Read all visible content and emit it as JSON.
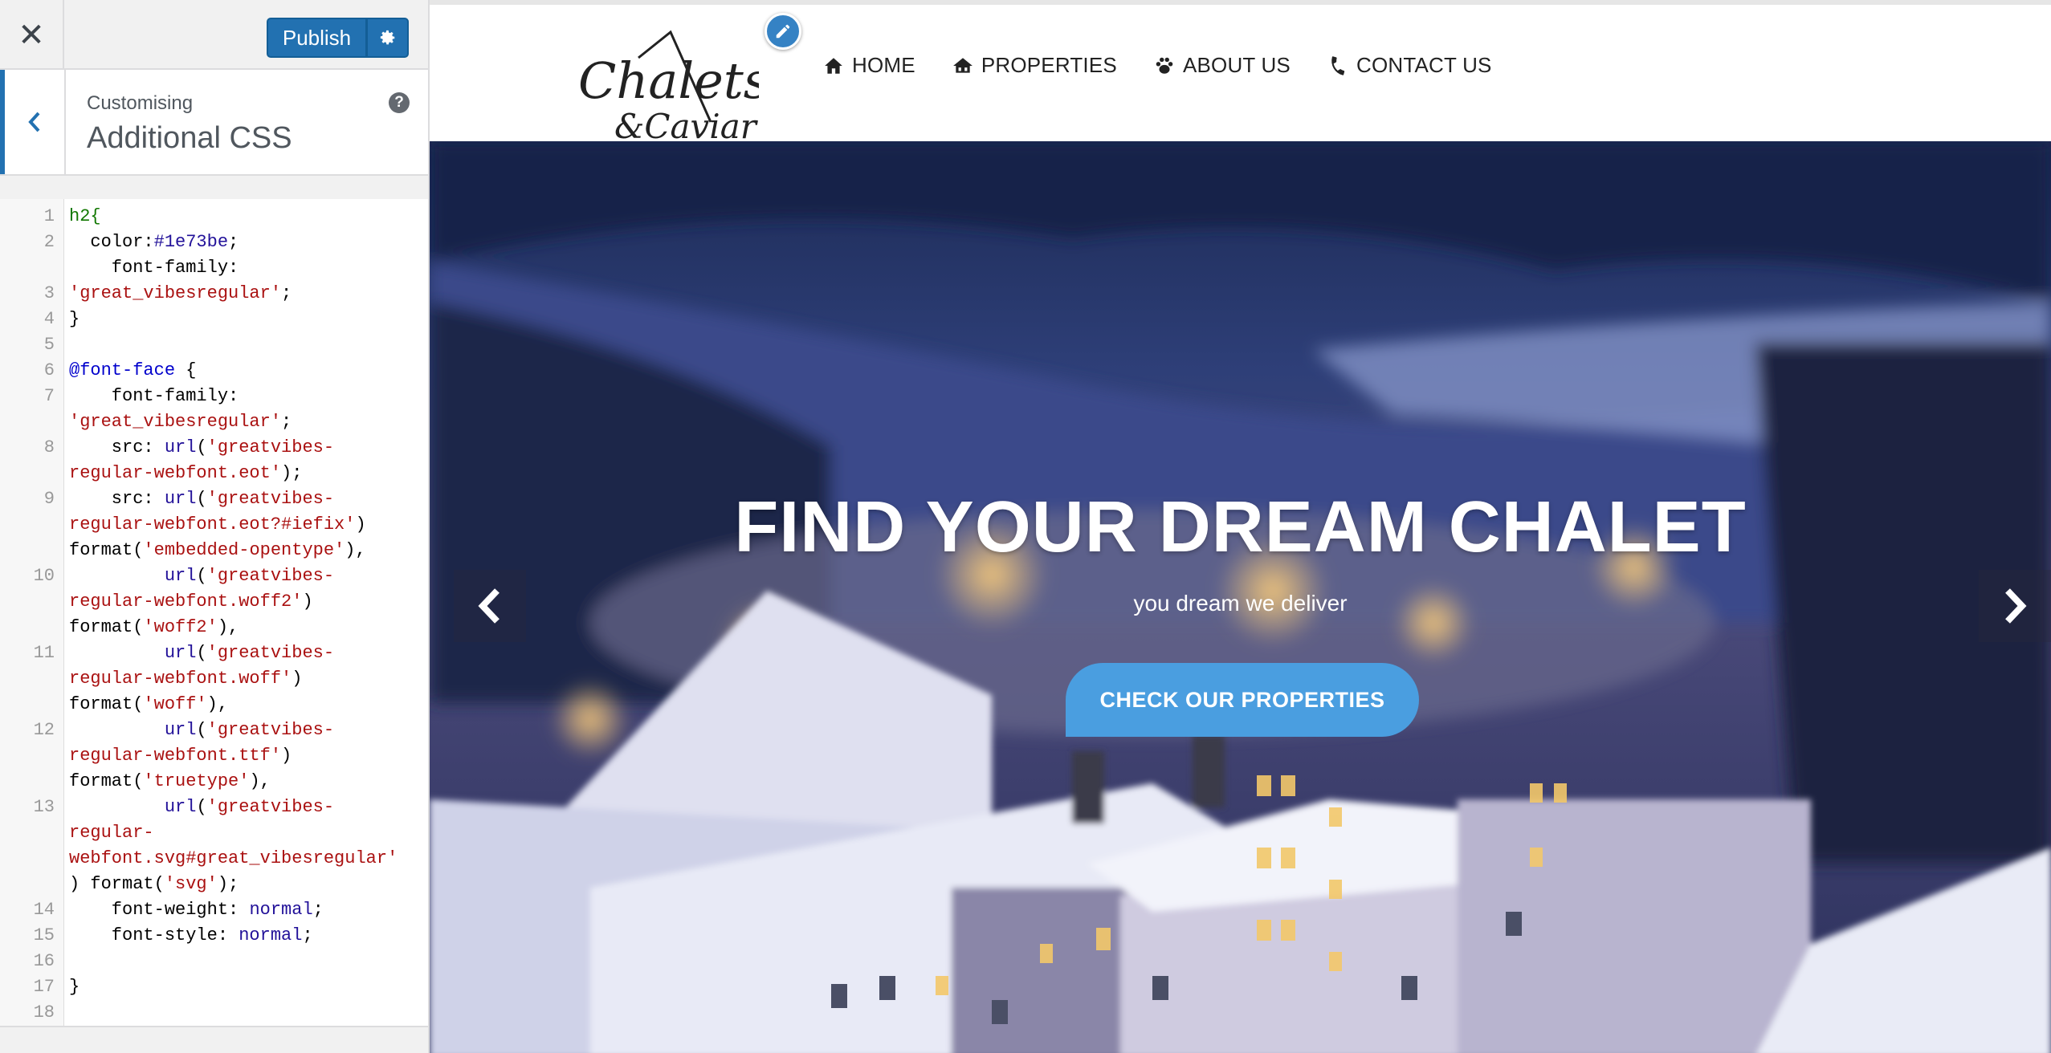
{
  "sidebar": {
    "close_icon": "close-icon",
    "publish_label": "Publish",
    "settings_icon": "gear-icon",
    "customising_label": "Customising",
    "section_title": "Additional CSS",
    "help_icon": "help-icon",
    "back_icon": "chevron-left-icon"
  },
  "code_lines": [
    {
      "num": "1"
    },
    {
      "num": "2"
    },
    {
      "num": ""
    },
    {
      "num": "3"
    },
    {
      "num": "4"
    },
    {
      "num": "5"
    },
    {
      "num": "6"
    },
    {
      "num": "7"
    },
    {
      "num": ""
    },
    {
      "num": "8"
    },
    {
      "num": ""
    },
    {
      "num": "9"
    },
    {
      "num": ""
    },
    {
      "num": ""
    },
    {
      "num": "10"
    },
    {
      "num": ""
    },
    {
      "num": ""
    },
    {
      "num": "11"
    },
    {
      "num": ""
    },
    {
      "num": ""
    },
    {
      "num": "12"
    },
    {
      "num": ""
    },
    {
      "num": ""
    },
    {
      "num": "13"
    },
    {
      "num": ""
    },
    {
      "num": ""
    },
    {
      "num": ""
    },
    {
      "num": "14"
    },
    {
      "num": "15"
    },
    {
      "num": "16"
    },
    {
      "num": "17"
    },
    {
      "num": "18"
    }
  ],
  "code_text": {
    "l1": "h2{",
    "l2_prop": "  color:",
    "l2_val": "#1e73be",
    "l2_end": ";",
    "l3a": "    font-family:",
    "l3b": "'great_vibesregular'",
    "l3b_end": ";",
    "l4": "}",
    "l6_kw": "@font-face",
    "l6_end": " {",
    "l7a": "    font-family:",
    "l7b": "'great_vibesregular'",
    "l7b_end": ";",
    "src": "    src: ",
    "url": "url",
    "l8a_str": "'greatvibes-",
    "l8b_str": "regular-webfont.eot'",
    "l8b_end": ");",
    "l9a_str": "'greatvibes-",
    "l9b_str": "regular-webfont.eot?#iefix'",
    "l9b_end": ")",
    "format": "format(",
    "l9c_str": "'embedded-opentype'",
    "l9c_end": "),",
    "indent": "         ",
    "l10a_str": "'greatvibes-",
    "l10b_str": "regular-webfont.woff2'",
    "l10b_end": ")",
    "l10c_str": "'woff2'",
    "l10c_end": "),",
    "l11a_str": "'greatvibes-",
    "l11b_str": "regular-webfont.woff'",
    "l11b_end": ")",
    "l11c_str": "'woff'",
    "l11c_end": "),",
    "l12a_str": "'greatvibes-",
    "l12b_str": "regular-webfont.ttf'",
    "l12b_end": ")",
    "l12c_str": "'truetype'",
    "l12c_end": "),",
    "l13a_str": "'greatvibes-",
    "l13b_str": "regular-",
    "l13c_str": "webfont.svg#great_vibesregular'",
    "l13d_start": ") ",
    "l13d_str": "'svg'",
    "l13d_end": ");",
    "l14a": "    font-weight: ",
    "l14b": "normal",
    "l14_end": ";",
    "l15a": "    font-style: ",
    "l15b": "normal",
    "l15_end": ";",
    "l17": "}",
    "paren": "("
  },
  "site": {
    "logo_text_1": "Chalets",
    "logo_text_2": "& Caviar",
    "edit_icon": "pencil-icon",
    "nav": [
      {
        "label": "HOME",
        "icon": "home-icon"
      },
      {
        "label": "PROPERTIES",
        "icon": "buildings-icon"
      },
      {
        "label": "ABOUT US",
        "icon": "paw-icon"
      },
      {
        "label": "CONTACT US",
        "icon": "phone-icon"
      }
    ],
    "hero_title": "FIND YOUR DREAM CHALET",
    "hero_subtitle": "you dream we deliver",
    "cta_label": "CHECK OUR PROPERTIES",
    "prev_icon": "chevron-left-icon",
    "next_icon": "chevron-right-icon"
  },
  "colors": {
    "publish": "#2271b1",
    "cta": "#4a9ee0",
    "edit_shortcut": "#3582c4"
  }
}
